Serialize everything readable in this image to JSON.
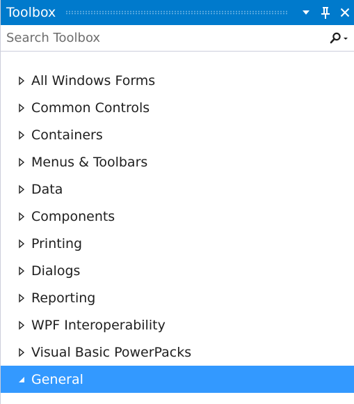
{
  "window": {
    "title": "Toolbox",
    "accent_color": "#007acc",
    "selection_color": "#3399ff"
  },
  "title_buttons": [
    {
      "name": "dropdown-icon"
    },
    {
      "name": "pin-icon"
    },
    {
      "name": "close-icon"
    }
  ],
  "search": {
    "placeholder": "Search Toolbox",
    "value": "",
    "icon": "search-icon"
  },
  "tree": {
    "items": [
      {
        "label": "All Windows Forms",
        "expanded": false,
        "selected": false
      },
      {
        "label": "Common Controls",
        "expanded": false,
        "selected": false
      },
      {
        "label": "Containers",
        "expanded": false,
        "selected": false
      },
      {
        "label": "Menus & Toolbars",
        "expanded": false,
        "selected": false
      },
      {
        "label": "Data",
        "expanded": false,
        "selected": false
      },
      {
        "label": "Components",
        "expanded": false,
        "selected": false
      },
      {
        "label": "Printing",
        "expanded": false,
        "selected": false
      },
      {
        "label": "Dialogs",
        "expanded": false,
        "selected": false
      },
      {
        "label": "Reporting",
        "expanded": false,
        "selected": false
      },
      {
        "label": "WPF Interoperability",
        "expanded": false,
        "selected": false
      },
      {
        "label": "Visual Basic PowerPacks",
        "expanded": false,
        "selected": false
      },
      {
        "label": "General",
        "expanded": true,
        "selected": true
      }
    ]
  }
}
